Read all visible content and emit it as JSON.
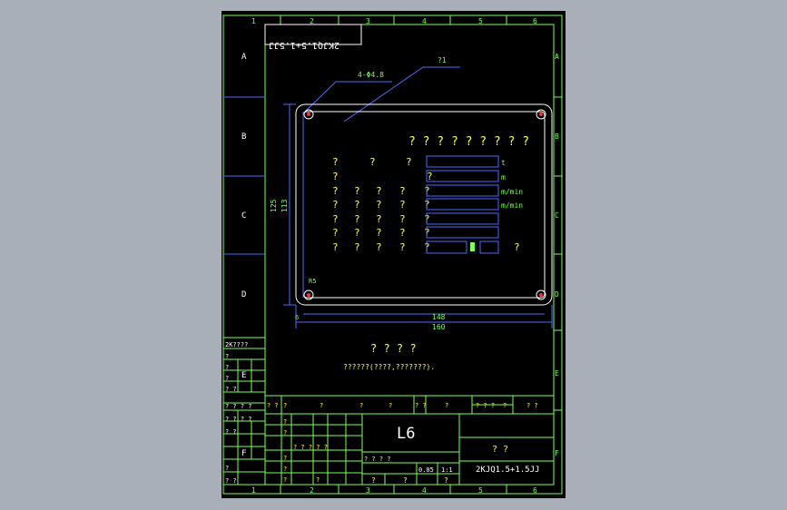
{
  "drawing": {
    "zone_numbers_top": [
      "1",
      "2",
      "3",
      "4",
      "5",
      "6"
    ],
    "zone_numbers_bottom": [
      "1",
      "2",
      "3",
      "4",
      "5",
      "6"
    ],
    "zone_letters_left": [
      "A",
      "B",
      "C",
      "D"
    ],
    "zone_letters_right": [
      "A",
      "B",
      "C",
      "D",
      "E",
      "F"
    ],
    "zone_letter_left_lower": [
      "E",
      "F"
    ],
    "mirror_code": "2KJQ1.5+1.5JJ",
    "callouts": {
      "holes": "4-Φ4.8",
      "plate": "?1"
    },
    "plate_title": "? ? ? ? ? ? ? ? ?",
    "fields": {
      "top_labels": [
        "?",
        "?",
        "?"
      ],
      "row_label": "?",
      "units": [
        "t",
        "m",
        "m/min",
        "m/min"
      ],
      "last_row_mark": "?"
    },
    "dims": {
      "inner_width": "148",
      "outer_width": "160",
      "outer_height": "125",
      "inner_height": "113",
      "corner_radius": "R5",
      "edge_offset": "6"
    },
    "note_title": "? ? ? ?",
    "note_text": "??????(????,???????).",
    "left_block": {
      "top_text": "2K????",
      "rows": [
        "?",
        "?",
        "?",
        "? ?",
        "? ? ? ?",
        "? ?  ? ?",
        "?  ?",
        "?",
        "?  ?"
      ]
    },
    "title_block": {
      "header_cells": [
        "? ?",
        "?",
        "?",
        "?",
        "?",
        "? ?",
        "?",
        "? ?  ?",
        "?",
        "? ?"
      ],
      "drawing_name": "L6",
      "product_name": "?  ?",
      "drawing_number": "2KJQ1.5+1.5JJ",
      "scale": "1:1",
      "sheet_label": "0.05",
      "stage_labels": [
        "?  ?  ?  ?",
        "?",
        "?",
        "?"
      ],
      "designer_rows": [
        "?",
        "?",
        "?",
        "?",
        "?",
        "?"
      ],
      "proc_row": "? ? ? ? ?"
    }
  }
}
